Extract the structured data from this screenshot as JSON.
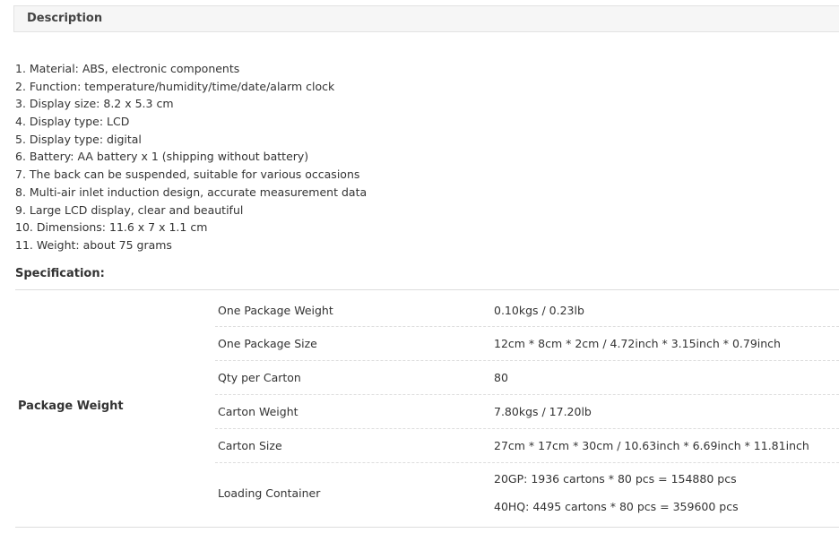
{
  "description": {
    "header": "Description",
    "items": [
      "1. Material: ABS, electronic components",
      "2. Function: temperature/humidity/time/date/alarm clock",
      "3. Display size: 8.2 x 5.3 cm",
      "4. Display type: LCD",
      "5. Display type: digital",
      "6. Battery: AA battery x 1 (shipping without battery)",
      "7. The back can be suspended, suitable for various occasions",
      "8. Multi-air inlet induction design, accurate measurement data",
      "9. Large LCD display, clear and beautiful",
      "10. Dimensions: 11.6 x 7 x 1.1 cm",
      "11. Weight: about 75 grams"
    ]
  },
  "specification": {
    "title": "Specification:",
    "group_label": "Package Weight",
    "rows": [
      {
        "key": "One Package Weight",
        "values": [
          "0.10kgs / 0.23lb"
        ]
      },
      {
        "key": "One Package Size",
        "values": [
          "12cm * 8cm * 2cm / 4.72inch * 3.15inch * 0.79inch"
        ]
      },
      {
        "key": "Qty per Carton",
        "values": [
          "80"
        ]
      },
      {
        "key": "Carton Weight",
        "values": [
          "7.80kgs / 17.20lb"
        ]
      },
      {
        "key": "Carton Size",
        "values": [
          "27cm * 17cm * 30cm / 10.63inch * 6.69inch * 11.81inch"
        ]
      },
      {
        "key": "Loading Container",
        "values": [
          "20GP: 1936 cartons * 80 pcs = 154880 pcs",
          "40HQ: 4495 cartons * 80 pcs = 359600 pcs"
        ]
      }
    ]
  }
}
